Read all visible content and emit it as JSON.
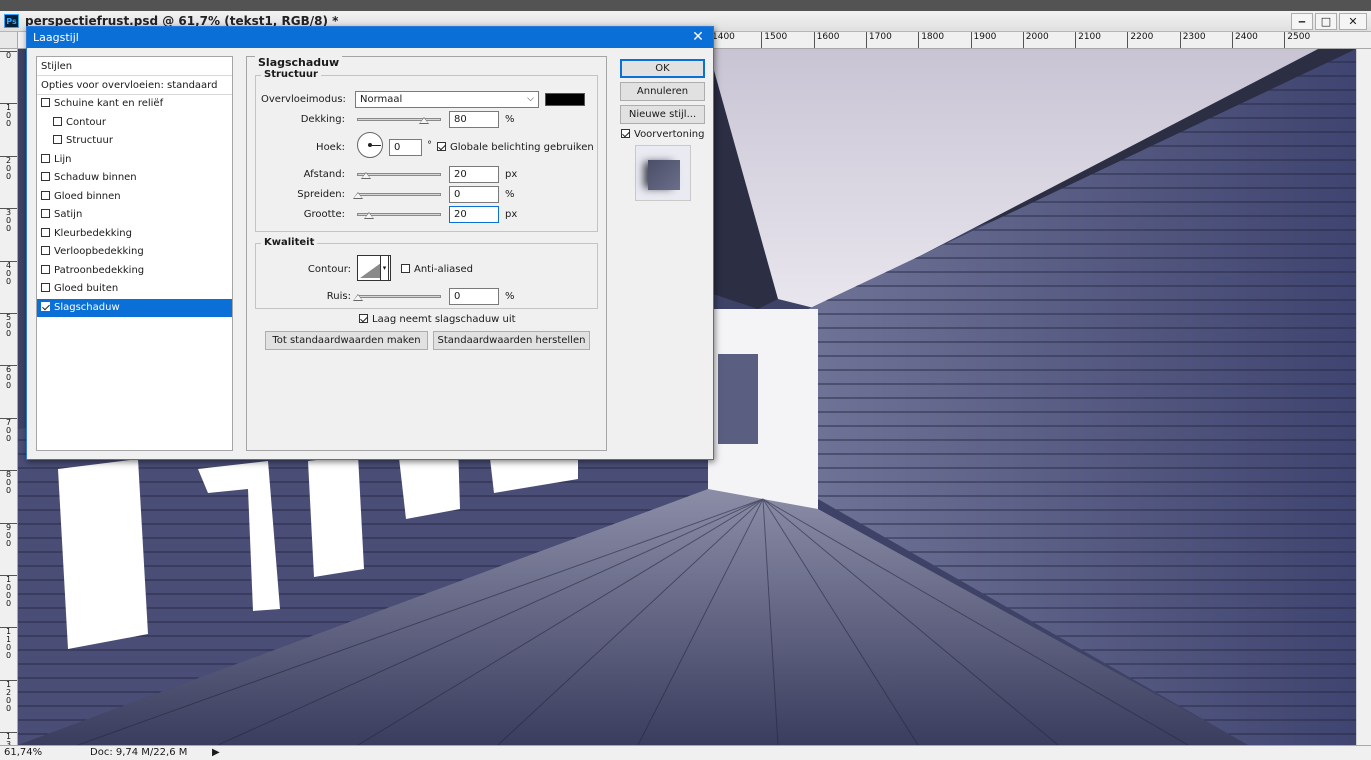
{
  "app": {
    "logo": "Ps",
    "doc_title": "perspectiefrust.psd @ 61,7% (tekst1, RGB/8) *",
    "win_min": "‒",
    "win_max": "□",
    "win_close": "✕"
  },
  "ruler": {
    "top_labels": [
      "1400",
      "1500",
      "1600",
      "1700",
      "1800",
      "1900",
      "2000",
      "2100",
      "2200",
      "2300",
      "2400",
      "2500"
    ],
    "left_labels": [
      "0",
      "1\n0\n0",
      "2\n0\n0",
      "3\n0\n0",
      "4\n0\n0",
      "5\n0\n0",
      "6\n0\n0",
      "7\n0\n0",
      "8\n0\n0",
      "9\n0\n0",
      "1\n0\n0\n0",
      "1\n1\n0\n0",
      "1\n2\n0\n0",
      "1\n3"
    ]
  },
  "status": {
    "zoom": "61,74%",
    "doc_size": "Doc: 9,74 M/22,6 M",
    "arrow": "▶"
  },
  "dialog": {
    "title": "Laagstijl",
    "close": "✕",
    "styles_list": [
      {
        "label": "Stijlen",
        "checkbox": false
      },
      {
        "label": "Opties voor overvloeien: standaard",
        "checkbox": false
      },
      {
        "label": "Schuine kant en reliëf",
        "checkbox": true,
        "checked": false
      },
      {
        "label": "Contour",
        "checkbox": true,
        "checked": false,
        "sub": true
      },
      {
        "label": "Structuur",
        "checkbox": true,
        "checked": false,
        "sub": true
      },
      {
        "label": "Lijn",
        "checkbox": true,
        "checked": false
      },
      {
        "label": "Schaduw binnen",
        "checkbox": true,
        "checked": false
      },
      {
        "label": "Gloed binnen",
        "checkbox": true,
        "checked": false
      },
      {
        "label": "Satijn",
        "checkbox": true,
        "checked": false
      },
      {
        "label": "Kleurbedekking",
        "checkbox": true,
        "checked": false
      },
      {
        "label": "Verloopbedekking",
        "checkbox": true,
        "checked": false
      },
      {
        "label": "Patroonbedekking",
        "checkbox": true,
        "checked": false
      },
      {
        "label": "Gloed buiten",
        "checkbox": true,
        "checked": false
      },
      {
        "label": "Slagschaduw",
        "checkbox": true,
        "checked": true,
        "selected": true
      }
    ],
    "section_title": "Slagschaduw",
    "structure": {
      "header": "Structuur",
      "blend_mode_label": "Overvloeimodus:",
      "blend_mode_value": "Normaal",
      "shadow_color": "#000000",
      "opacity_label": "Dekking:",
      "opacity_value": "80",
      "opacity_unit": "%",
      "opacity_level": 0.8,
      "angle_label": "Hoek:",
      "angle_value": "0",
      "angle_unit": "°",
      "global_light_label": "Globale belichting gebruiken",
      "global_light_checked": true,
      "distance_label": "Afstand:",
      "distance_value": "20",
      "distance_unit": "px",
      "spread_label": "Spreiden:",
      "spread_value": "0",
      "spread_unit": "%",
      "size_label": "Grootte:",
      "size_value": "20",
      "size_unit": "px"
    },
    "quality": {
      "header": "Kwaliteit",
      "contour_label": "Contour:",
      "anti_aliased_label": "Anti-aliased",
      "anti_aliased_checked": false,
      "noise_label": "Ruis:",
      "noise_value": "0",
      "noise_unit": "%"
    },
    "layer_knocks_out_label": "Laag neemt slagschaduw uit",
    "layer_knocks_out_checked": true,
    "make_default_label": "Tot standaardwaarden maken",
    "reset_default_label": "Standaardwaarden herstellen",
    "ok_label": "OK",
    "cancel_label": "Annuleren",
    "new_style_label": "Nieuwe stijl...",
    "preview_label": "Voorvertoning",
    "preview_checked": true
  }
}
